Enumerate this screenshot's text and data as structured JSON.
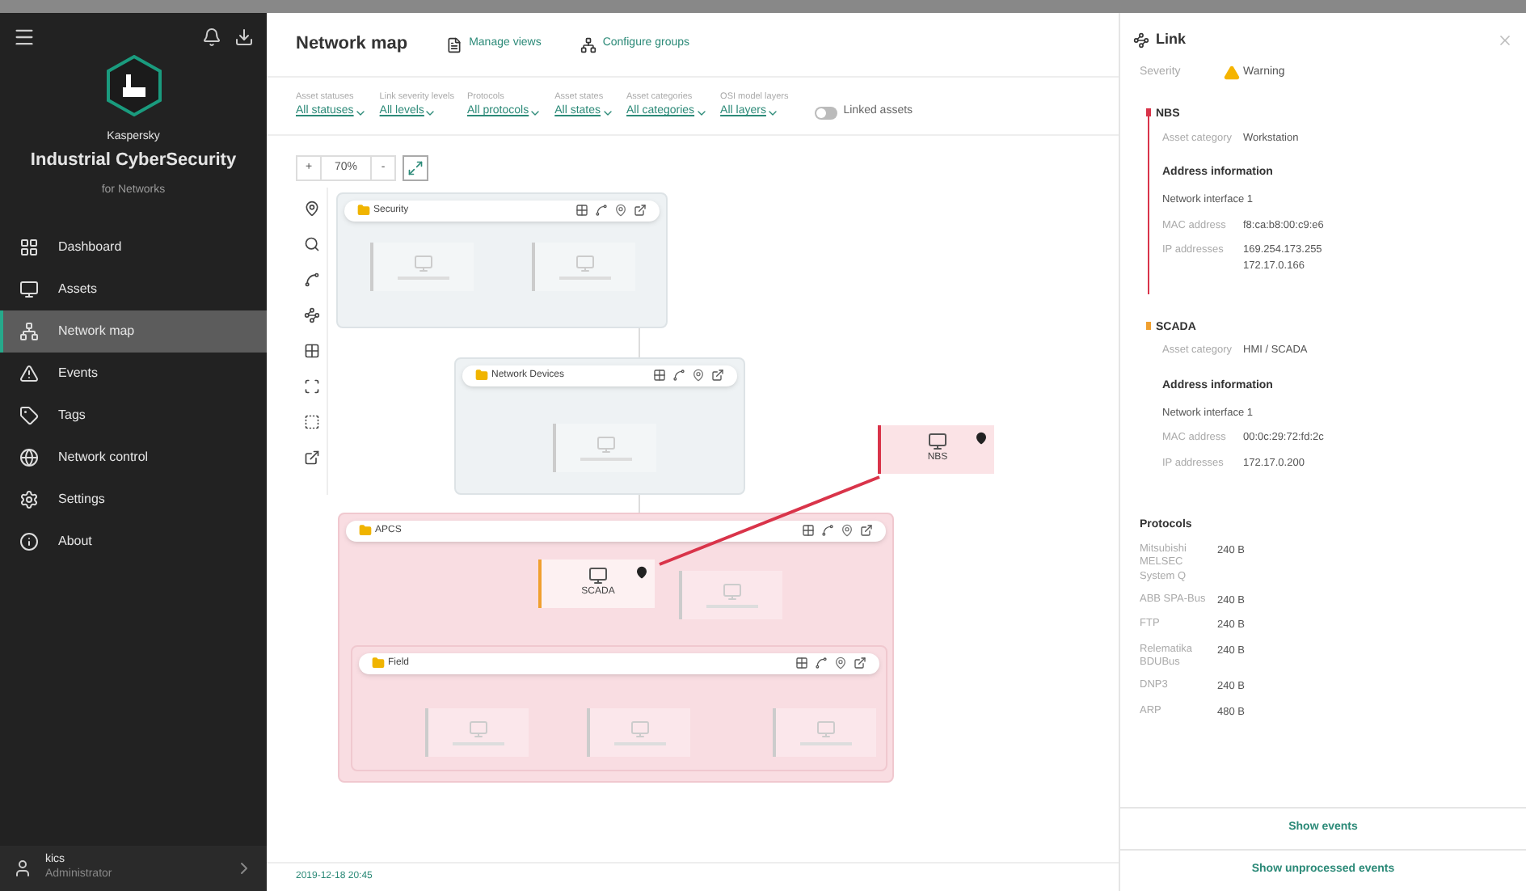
{
  "sidebar": {
    "brand_top": "Kaspersky",
    "brand": "Industrial CyberSecurity",
    "brand_sub": "for Networks",
    "items": [
      {
        "label": "Dashboard",
        "selected": false
      },
      {
        "label": "Assets",
        "selected": false
      },
      {
        "label": "Network map",
        "selected": true
      },
      {
        "label": "Events",
        "selected": false
      },
      {
        "label": "Tags",
        "selected": false
      },
      {
        "label": "Network control",
        "selected": false
      },
      {
        "label": "Settings",
        "selected": false
      },
      {
        "label": "About",
        "selected": false
      }
    ],
    "user": {
      "name": "kics",
      "role": "Administrator"
    }
  },
  "header": {
    "title": "Network map",
    "actions": [
      "Manage views",
      "Configure groups"
    ]
  },
  "filters": [
    {
      "label": "Asset statuses",
      "value": "All statuses"
    },
    {
      "label": "Link severity levels",
      "value": "All levels"
    },
    {
      "label": "Protocols",
      "value": "All protocols"
    },
    {
      "label": "Asset states",
      "value": "All states"
    },
    {
      "label": "Asset categories",
      "value": "All categories"
    },
    {
      "label": "OSI model layers",
      "value": "All layers"
    }
  ],
  "linked_assets": {
    "label": "Linked assets",
    "on": false
  },
  "zoom": {
    "plus": "+",
    "value": "70%",
    "minus": "-"
  },
  "map": {
    "groups": [
      {
        "name": "Security",
        "kind": "normal"
      },
      {
        "name": "Network Devices",
        "kind": "normal"
      },
      {
        "name": "APCS",
        "kind": "alert"
      },
      {
        "name": "Field",
        "kind": "alert"
      }
    ],
    "nodes": [
      {
        "label": "NBS",
        "kind": "alert"
      },
      {
        "label": "SCADA",
        "kind": "active"
      }
    ]
  },
  "timestamp": "2019-12-18 20:45",
  "panel": {
    "title": "Link",
    "severity": {
      "label": "Severity",
      "value": "Warning"
    },
    "endpoints": [
      {
        "name": "NBS",
        "color": "#d9344a",
        "category_label": "Asset category",
        "category": "Workstation",
        "address_title": "Address information",
        "interface": "Network interface 1",
        "mac_label": "MAC address",
        "mac": "f8:ca:b8:00:c9:e6",
        "ip_label": "IP addresses",
        "ips": [
          "169.254.173.255",
          "172.17.0.166"
        ]
      },
      {
        "name": "SCADA",
        "color": "#f0a030",
        "category_label": "Asset category",
        "category": "HMI / SCADA",
        "address_title": "Address information",
        "interface": "Network interface 1",
        "mac_label": "MAC address",
        "mac": "00:0c:29:72:fd:2c",
        "ip_label": "IP addresses",
        "ips": [
          "172.17.0.200"
        ]
      }
    ],
    "protocols_title": "Protocols",
    "protocols": [
      {
        "name": "Mitsubishi MELSEC System Q",
        "size": "240 B"
      },
      {
        "name": "ABB SPA-Bus",
        "size": "240 B"
      },
      {
        "name": "FTP",
        "size": "240 B"
      },
      {
        "name": "Relematika BDUBus",
        "size": "240 B"
      },
      {
        "name": "DNP3",
        "size": "240 B"
      },
      {
        "name": "ARP",
        "size": "480 B"
      }
    ],
    "buttons": [
      "Show events",
      "Show unprocessed events"
    ]
  }
}
